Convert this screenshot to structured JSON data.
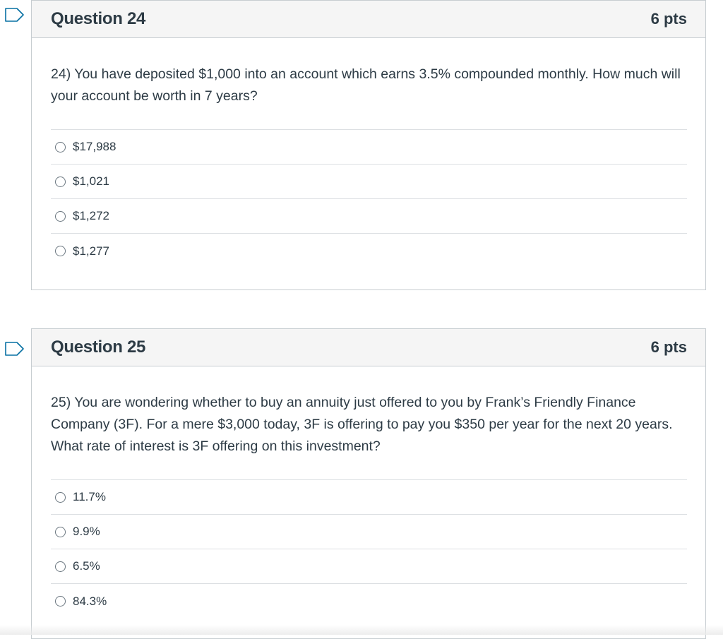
{
  "questions": [
    {
      "title": "Question 24",
      "points": "6 pts",
      "text": "24) You have deposited $1,000 into an account which earns 3.5% compounded monthly.  How much will your account be worth in 7 years?",
      "answers": [
        "$17,988",
        "$1,021",
        "$1,272",
        "$1,277"
      ]
    },
    {
      "title": "Question 25",
      "points": "6 pts",
      "text": "25) You are wondering whether to buy an annuity just offered to you by Frank’s Friendly Finance Company (3F).   For a mere $3,000 today, 3F is offering to pay you $350 per year for the next 20 years.  What rate of interest is 3F offering on this investment?",
      "answers": [
        "11.7%",
        "9.9%",
        "6.5%",
        "84.3%"
      ]
    }
  ],
  "icons": {
    "flag": "flag-question-icon"
  },
  "colors": {
    "flag": "#0770a3",
    "text": "#2d3b45",
    "border": "#c7cdd1",
    "header_bg": "#f5f5f5"
  }
}
